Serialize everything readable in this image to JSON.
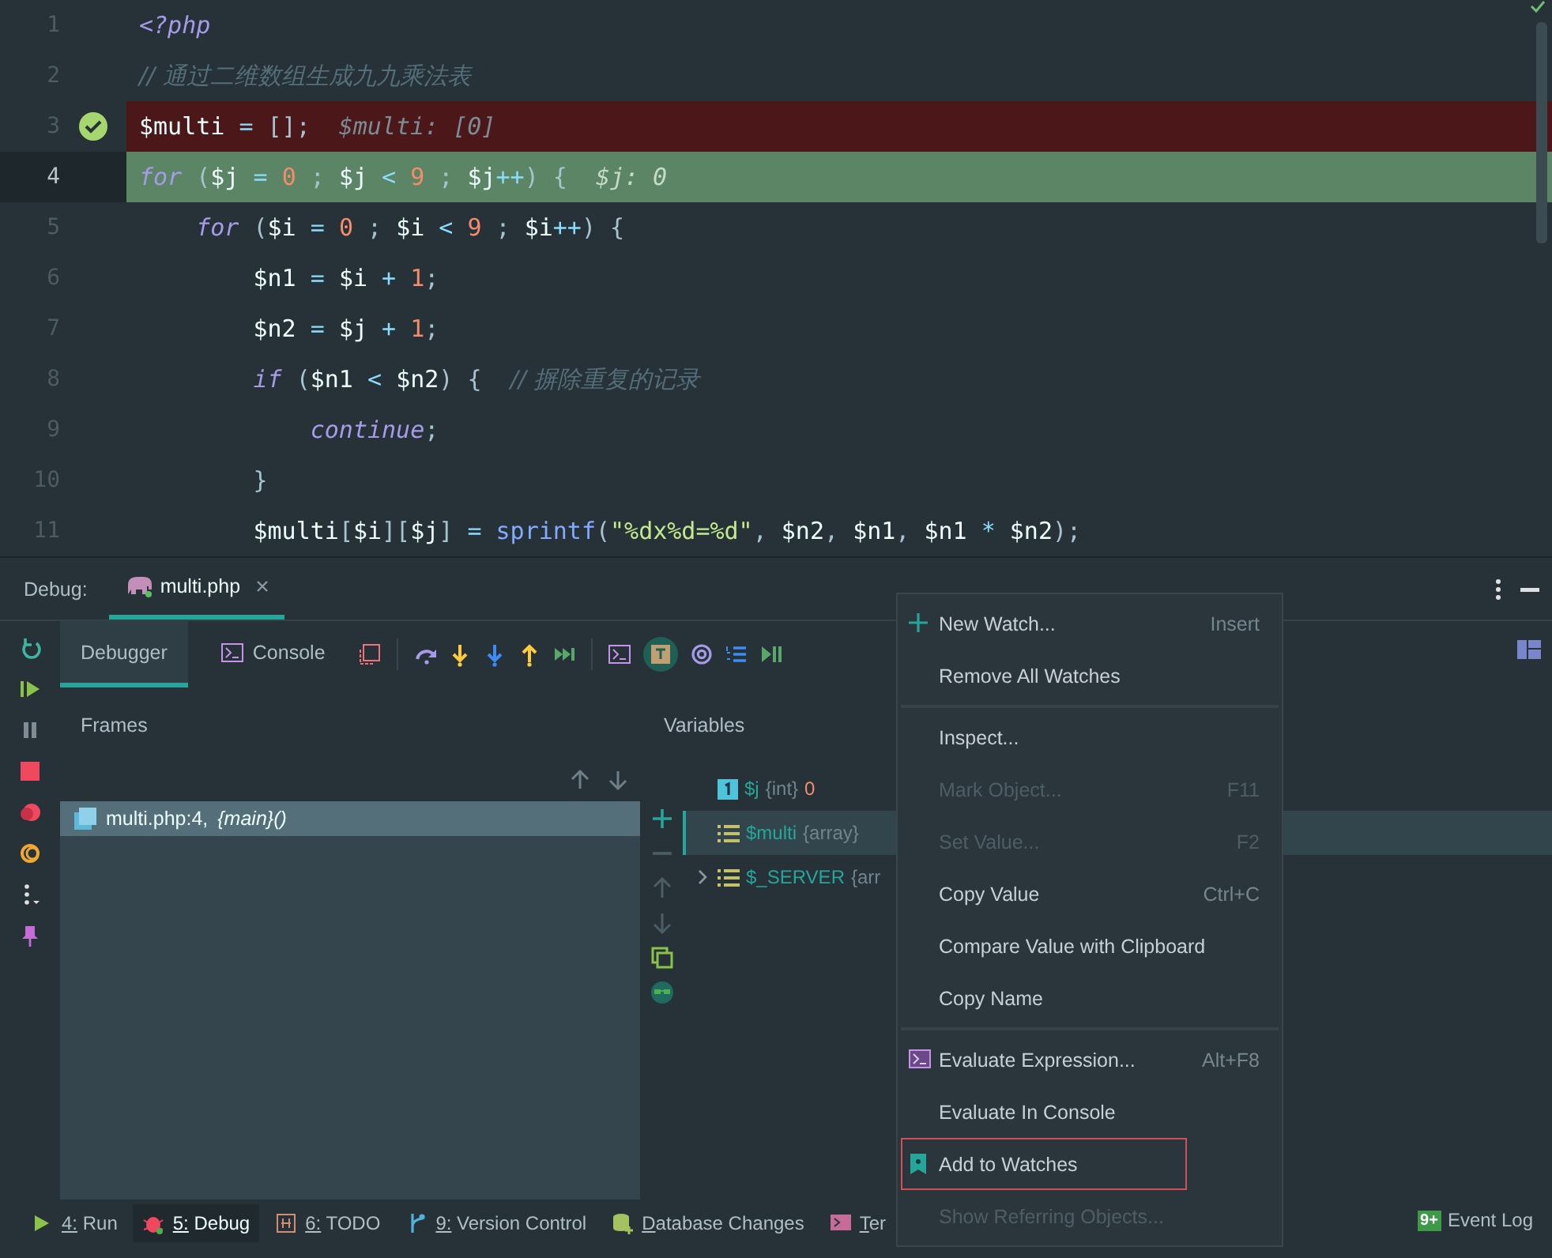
{
  "editor": {
    "lines": [
      {
        "number": "1",
        "breakpoint": false,
        "current": false,
        "tokens": [
          {
            "kind": "tag",
            "text": "<?php"
          }
        ]
      },
      {
        "number": "2",
        "breakpoint": false,
        "current": false,
        "tokens": [
          {
            "kind": "comment",
            "text": "// 通过二维数组生成九九乘法表"
          }
        ]
      },
      {
        "number": "3",
        "breakpoint": true,
        "current": false,
        "tokens": [
          {
            "kind": "plain",
            "text": "$multi"
          },
          {
            "kind": "op",
            "text": " = "
          },
          {
            "kind": "punct",
            "text": "[];"
          },
          {
            "kind": "hint",
            "text": "$multi: [0]"
          }
        ]
      },
      {
        "number": "4",
        "breakpoint": false,
        "current": true,
        "tokens": [
          {
            "kind": "keyword",
            "text": "for"
          },
          {
            "kind": "punct",
            "text": " ("
          },
          {
            "kind": "var",
            "text": "$j"
          },
          {
            "kind": "op",
            "text": " = "
          },
          {
            "kind": "num",
            "text": "0"
          },
          {
            "kind": "punct",
            "text": " ; "
          },
          {
            "kind": "var",
            "text": "$j"
          },
          {
            "kind": "op",
            "text": " < "
          },
          {
            "kind": "num",
            "text": "9"
          },
          {
            "kind": "punct",
            "text": " ; "
          },
          {
            "kind": "var",
            "text": "$j"
          },
          {
            "kind": "op",
            "text": "++"
          },
          {
            "kind": "punct",
            "text": ") {"
          },
          {
            "kind": "hint",
            "text": "$j: 0"
          }
        ]
      },
      {
        "number": "5",
        "breakpoint": false,
        "current": false,
        "tokens": [
          {
            "kind": "keyword",
            "text": "    for"
          },
          {
            "kind": "punct",
            "text": " ("
          },
          {
            "kind": "var",
            "text": "$i"
          },
          {
            "kind": "op",
            "text": " = "
          },
          {
            "kind": "num",
            "text": "0"
          },
          {
            "kind": "punct",
            "text": " ; "
          },
          {
            "kind": "var",
            "text": "$i"
          },
          {
            "kind": "op",
            "text": " < "
          },
          {
            "kind": "num",
            "text": "9"
          },
          {
            "kind": "punct",
            "text": " ; "
          },
          {
            "kind": "var",
            "text": "$i"
          },
          {
            "kind": "op",
            "text": "++"
          },
          {
            "kind": "punct",
            "text": ") {"
          }
        ]
      },
      {
        "number": "6",
        "breakpoint": false,
        "current": false,
        "tokens": [
          {
            "kind": "var",
            "text": "        $n1"
          },
          {
            "kind": "op",
            "text": " = "
          },
          {
            "kind": "var",
            "text": "$i"
          },
          {
            "kind": "op",
            "text": " + "
          },
          {
            "kind": "num",
            "text": "1"
          },
          {
            "kind": "punct",
            "text": ";"
          }
        ]
      },
      {
        "number": "7",
        "breakpoint": false,
        "current": false,
        "tokens": [
          {
            "kind": "var",
            "text": "        $n2"
          },
          {
            "kind": "op",
            "text": " = "
          },
          {
            "kind": "var",
            "text": "$j"
          },
          {
            "kind": "op",
            "text": " + "
          },
          {
            "kind": "num",
            "text": "1"
          },
          {
            "kind": "punct",
            "text": ";"
          }
        ]
      },
      {
        "number": "8",
        "breakpoint": false,
        "current": false,
        "tokens": [
          {
            "kind": "keyword",
            "text": "        if"
          },
          {
            "kind": "punct",
            "text": " ("
          },
          {
            "kind": "var",
            "text": "$n1"
          },
          {
            "kind": "op",
            "text": " < "
          },
          {
            "kind": "var",
            "text": "$n2"
          },
          {
            "kind": "punct",
            "text": ") {  "
          },
          {
            "kind": "comment",
            "text": "// 摒除重复的记录"
          }
        ]
      },
      {
        "number": "9",
        "breakpoint": false,
        "current": false,
        "tokens": [
          {
            "kind": "keyword",
            "text": "            continue"
          },
          {
            "kind": "punct",
            "text": ";"
          }
        ]
      },
      {
        "number": "10",
        "breakpoint": false,
        "current": false,
        "tokens": [
          {
            "kind": "punct",
            "text": "        }"
          }
        ]
      },
      {
        "number": "11",
        "breakpoint": false,
        "current": false,
        "tokens": [
          {
            "kind": "var",
            "text": "        $multi"
          },
          {
            "kind": "punct",
            "text": "["
          },
          {
            "kind": "var",
            "text": "$i"
          },
          {
            "kind": "punct",
            "text": "]["
          },
          {
            "kind": "var",
            "text": "$j"
          },
          {
            "kind": "punct",
            "text": "]"
          },
          {
            "kind": "op",
            "text": " = "
          },
          {
            "kind": "func",
            "text": "sprintf"
          },
          {
            "kind": "punct",
            "text": "("
          },
          {
            "kind": "str",
            "text": "\"%dx%d=%d\""
          },
          {
            "kind": "punct",
            "text": ", "
          },
          {
            "kind": "var",
            "text": "$n2"
          },
          {
            "kind": "punct",
            "text": ", "
          },
          {
            "kind": "var",
            "text": "$n1"
          },
          {
            "kind": "punct",
            "text": ", "
          },
          {
            "kind": "var",
            "text": "$n1"
          },
          {
            "kind": "op",
            "text": " * "
          },
          {
            "kind": "var",
            "text": "$n2"
          },
          {
            "kind": "punct",
            "text": ");"
          }
        ]
      }
    ]
  },
  "debug": {
    "label": "Debug:",
    "session_tab": {
      "label": "multi.php"
    },
    "tabs": [
      {
        "label": "Debugger",
        "kind": "plain",
        "selected": true
      },
      {
        "label": "Console",
        "kind": "console",
        "selected": false
      }
    ],
    "frames": {
      "title": "Frames",
      "items": [
        {
          "location": "multi.php:4,",
          "function": "{main}()",
          "selected": true
        }
      ]
    },
    "variables": {
      "title": "Variables",
      "items": [
        {
          "name": "$j",
          "type": "{int}",
          "value": "0",
          "kind": "int",
          "expandable": false,
          "selected": false
        },
        {
          "name": "$multi",
          "type": "{array}",
          "kind": "array",
          "expandable": false,
          "selected": true
        },
        {
          "name": "$_SERVER",
          "type": "{arr",
          "kind": "array",
          "expandable": true,
          "selected": false
        }
      ]
    }
  },
  "context_menu": {
    "groups": [
      [
        {
          "label": "New Watch...",
          "shortcut": "Insert",
          "kind": "add",
          "disabled": false,
          "outlined": false
        },
        {
          "label": "Remove All Watches",
          "kind": "plain",
          "disabled": false,
          "outlined": false
        }
      ],
      [
        {
          "label": "Inspect...",
          "kind": "plain",
          "disabled": false,
          "outlined": false
        },
        {
          "label": "Mark Object...",
          "shortcut": "F11",
          "kind": "plain",
          "disabled": true,
          "outlined": false
        },
        {
          "label": "Set Value...",
          "shortcut": "F2",
          "kind": "plain",
          "disabled": true,
          "outlined": false
        },
        {
          "label": "Copy Value",
          "shortcut": "Ctrl+C",
          "kind": "plain",
          "disabled": false,
          "outlined": false
        },
        {
          "label": "Compare Value with Clipboard",
          "kind": "plain",
          "disabled": false,
          "outlined": false
        },
        {
          "label": "Copy Name",
          "kind": "plain",
          "disabled": false,
          "outlined": false
        }
      ],
      [
        {
          "label": "Evaluate Expression...",
          "shortcut": "Alt+F8",
          "kind": "evaluate",
          "disabled": false,
          "outlined": false
        },
        {
          "label": "Evaluate In Console",
          "kind": "plain",
          "disabled": false,
          "outlined": false
        },
        {
          "label": "Add to Watches",
          "kind": "watch",
          "disabled": false,
          "outlined": true
        },
        {
          "label": "Show Referring Objects...",
          "kind": "plain",
          "disabled": true,
          "outlined": false
        }
      ]
    ]
  },
  "tool_windows": [
    {
      "label": "4: Run",
      "kind": "run",
      "selected": false
    },
    {
      "label": "5: Debug",
      "kind": "debug",
      "selected": true
    },
    {
      "label": "6: TODO",
      "kind": "todo",
      "selected": false
    },
    {
      "label": "9: Version Control",
      "kind": "vcs",
      "selected": false
    },
    {
      "label": "Database Changes",
      "kind": "database",
      "selected": false
    },
    {
      "label": "Ter",
      "kind": "terminal",
      "selected": false
    }
  ],
  "event_log": {
    "badge": "9+",
    "label": "Event Log"
  }
}
